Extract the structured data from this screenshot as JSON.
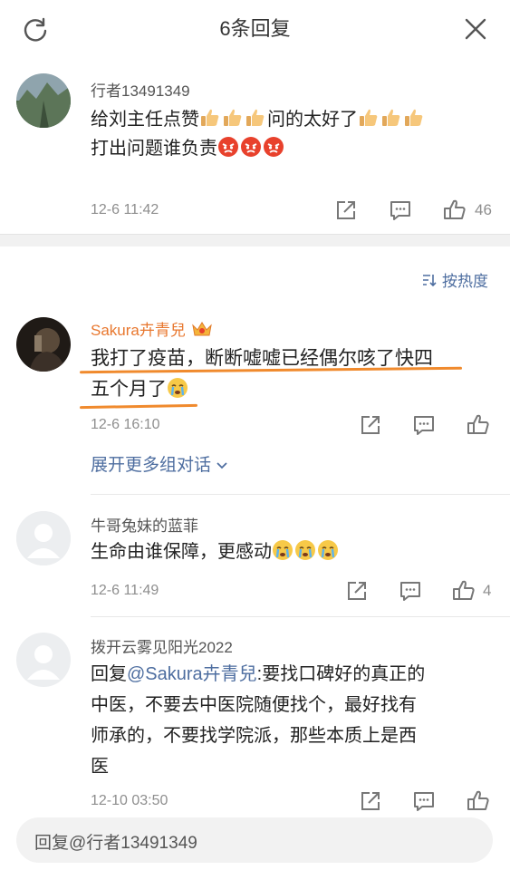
{
  "header": {
    "title": "6条回复"
  },
  "main_post": {
    "username": "行者13491349",
    "line1_a": "给刘主任点赞",
    "line1_b": "问的太好了",
    "line2": "打出问题谁负责",
    "time": "12-6 11:42",
    "likes": "46"
  },
  "sort": {
    "label": "按热度"
  },
  "replies": [
    {
      "username": "Sakura卉青兒",
      "line1": "我打了疫苗，断断嘘嘘已经偶尔咳了快四",
      "line2": "五个月了",
      "time": "12-6 16:10"
    },
    {
      "username": "牛哥兔妹的蓝菲",
      "line1": "生命由谁保障，更感动",
      "time": "12-6 11:49",
      "likes": "4"
    },
    {
      "username": "拨开云雾见阳光2022",
      "reply_prefix": "回复",
      "mention": "@Sakura卉青兒",
      "line1_rest": ":要找口碑好的真正的",
      "line2": "中医，不要去中医院随便找个，最好找有",
      "line3": "师承的，不要找学院派，那些本质上是西",
      "line4": "医",
      "time": "12-10 03:50"
    }
  ],
  "expand": {
    "label": "展开更多组对话"
  },
  "reply_bar": {
    "placeholder": "回复@行者13491349"
  },
  "colors": {
    "link": "#4e6ea0",
    "highlight_underline": "#f08a2d",
    "username_orange": "#e8772e"
  }
}
